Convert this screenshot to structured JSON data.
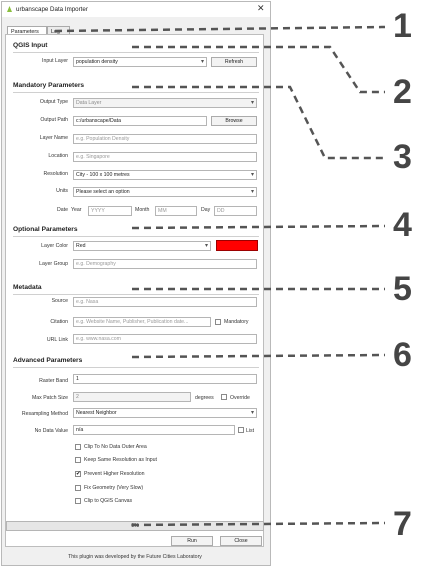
{
  "window": {
    "title": "urbanscape Data Importer",
    "close_glyph": "✕"
  },
  "tabs": [
    {
      "label": "Parameters",
      "active": true
    },
    {
      "label": "Log",
      "active": false
    }
  ],
  "qgis_input": {
    "heading": "QGIS Input",
    "input_layer_label": "Input Layer",
    "input_layer_value": "population density",
    "refresh_label": "Refresh"
  },
  "mandatory": {
    "heading": "Mandatory Parameters",
    "output_type_label": "Output Type",
    "output_type_value": "Data Layer",
    "output_path_label": "Output Path",
    "output_path_value": "c:/urbanscape/Data",
    "browse_label": "Browse",
    "layer_name_label": "Layer Name",
    "layer_name_placeholder": "e.g. Population Density",
    "location_label": "Location",
    "location_placeholder": "e.g. Singapore",
    "resolution_label": "Resolution",
    "resolution_value": "City - 100 x 100 metres",
    "units_label": "Units",
    "units_value": "Please select an option",
    "date_label": "Date",
    "year_label": "Year",
    "year_placeholder": "YYYY",
    "month_label": "Month",
    "month_placeholder": "MM",
    "day_label": "Day",
    "day_placeholder": "DD"
  },
  "optional": {
    "heading": "Optional Parameters",
    "layer_color_label": "Layer Color",
    "layer_color_value": "Red",
    "layer_color_hex": "#ff0000",
    "layer_group_label": "Layer Group",
    "layer_group_placeholder": "e.g. Demography"
  },
  "metadata": {
    "heading": "Metadata",
    "source_label": "Source",
    "source_placeholder": "e.g. Nasa",
    "citation_label": "Citation",
    "citation_placeholder": "e.g. Website Name, Publisher, Publication date...",
    "mandatory_label": "Mandatory",
    "url_label": "URL Link",
    "url_placeholder": "e.g. www.nasa.com"
  },
  "advanced": {
    "heading": "Advanced Parameters",
    "raster_band_label": "Raster Band",
    "raster_band_value": "1",
    "max_patch_label": "Max Patch Size",
    "max_patch_value": "2",
    "degrees_label": "degrees",
    "override_label": "Override",
    "resampling_label": "Resampling Method",
    "resampling_value": "Nearest Neighbor",
    "no_data_label": "No Data Value",
    "no_data_value": "n/a",
    "list_label": "List",
    "clip_no_data_label": "Clip To No Data Outer Area",
    "keep_resolution_label": "Keep Same Resolution as Input",
    "prevent_higher_label": "Prevent Higher Resolution",
    "fix_geometry_label": "Fix Geometry (Very Slow)",
    "clip_canvas_label": "Clip to QGIS Canvas",
    "checked_glyph": "✔"
  },
  "progress": {
    "text": "0%",
    "percent": 0
  },
  "actions": {
    "run_label": "Run",
    "close_label": "Close"
  },
  "footer": {
    "text": "This plugin was developed by the Future Cities Laboratory"
  },
  "callouts": [
    "1",
    "2",
    "3",
    "4",
    "5",
    "6",
    "7"
  ]
}
